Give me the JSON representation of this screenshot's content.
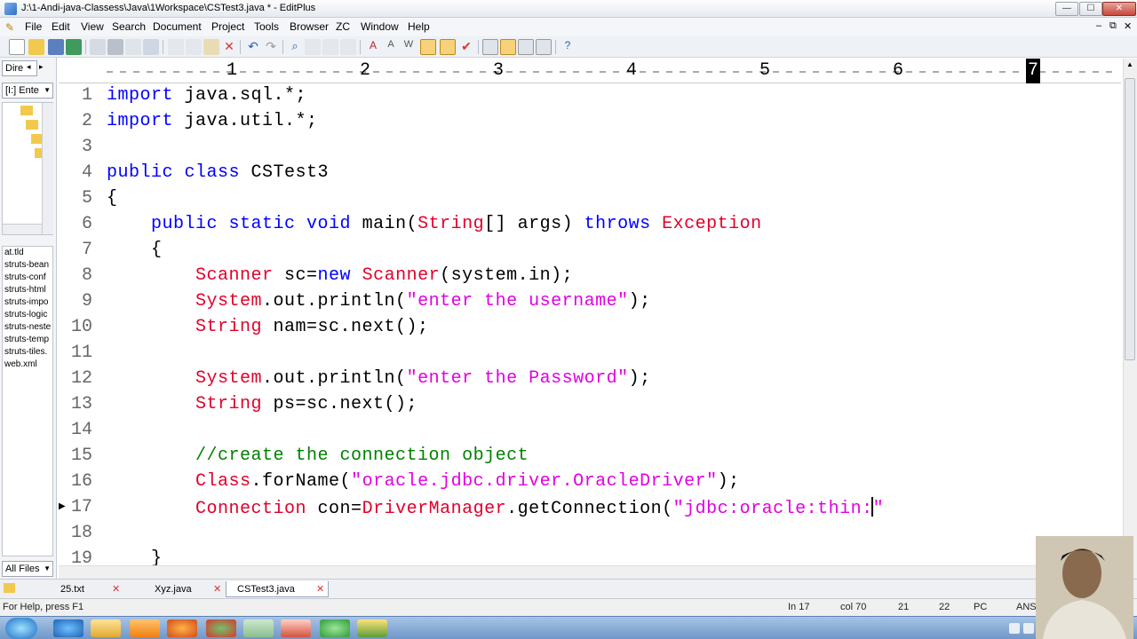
{
  "window": {
    "title": "J:\\1-Andi-java-Classess\\Java\\1Workspace\\CSTest3.java * - EditPlus",
    "min": "—",
    "max": "☐",
    "close": "✕"
  },
  "menu": [
    "File",
    "Edit",
    "View",
    "Search",
    "Document",
    "Project",
    "Tools",
    "Browser",
    "ZC",
    "Window",
    "Help"
  ],
  "left_panel": {
    "tab_label": "Dire",
    "drive": "[I:] Ente",
    "files": [
      "at.tld",
      "struts-bean",
      "struts-conf",
      "struts-html",
      "struts-impo",
      "struts-logic",
      "struts-neste",
      "struts-temp",
      "struts-tiles.",
      "web.xml"
    ],
    "filter": "All Files"
  },
  "ruler": {
    "numbers": [
      "1",
      "2",
      "3",
      "4",
      "5",
      "6"
    ],
    "marker": "7"
  },
  "editor": {
    "lines": [
      {
        "n": "1",
        "segs": [
          [
            "kw",
            "import"
          ],
          [
            "",
            " java.sql.*;"
          ]
        ]
      },
      {
        "n": "2",
        "segs": [
          [
            "kw",
            "import"
          ],
          [
            "",
            " java.util.*;"
          ]
        ]
      },
      {
        "n": "3",
        "segs": []
      },
      {
        "n": "4",
        "segs": [
          [
            "kw",
            "public class"
          ],
          [
            "",
            " CSTest3"
          ]
        ]
      },
      {
        "n": "5",
        "segs": [
          [
            "",
            "{"
          ]
        ]
      },
      {
        "n": "6",
        "segs": [
          [
            "",
            "    "
          ],
          [
            "kw",
            "public static void"
          ],
          [
            "",
            " main("
          ],
          [
            "ty",
            "String"
          ],
          [
            "",
            "[] args) "
          ],
          [
            "kw",
            "throws"
          ],
          [
            "",
            " "
          ],
          [
            "ty",
            "Exception"
          ]
        ]
      },
      {
        "n": "7",
        "segs": [
          [
            "",
            "    {"
          ]
        ]
      },
      {
        "n": "8",
        "segs": [
          [
            "",
            "        "
          ],
          [
            "ty",
            "Scanner"
          ],
          [
            "",
            " sc="
          ],
          [
            "kw",
            "new"
          ],
          [
            "",
            " "
          ],
          [
            "ty",
            "Scanner"
          ],
          [
            "",
            "(system.in);"
          ]
        ]
      },
      {
        "n": "9",
        "segs": [
          [
            "",
            "        "
          ],
          [
            "ty",
            "System"
          ],
          [
            "",
            ".out.println("
          ],
          [
            "st",
            "\"enter the username\""
          ],
          [
            "",
            ");"
          ]
        ]
      },
      {
        "n": "10",
        "segs": [
          [
            "",
            "        "
          ],
          [
            "ty",
            "String"
          ],
          [
            "",
            " nam=sc.next();"
          ]
        ]
      },
      {
        "n": "11",
        "segs": []
      },
      {
        "n": "12",
        "segs": [
          [
            "",
            "        "
          ],
          [
            "ty",
            "System"
          ],
          [
            "",
            ".out.println("
          ],
          [
            "st",
            "\"enter the Password\""
          ],
          [
            "",
            ");"
          ]
        ]
      },
      {
        "n": "13",
        "segs": [
          [
            "",
            "        "
          ],
          [
            "ty",
            "String"
          ],
          [
            "",
            " ps=sc.next();"
          ]
        ]
      },
      {
        "n": "14",
        "segs": []
      },
      {
        "n": "15",
        "segs": [
          [
            "",
            "        "
          ],
          [
            "cm",
            "//create the connection object"
          ]
        ]
      },
      {
        "n": "16",
        "segs": [
          [
            "",
            "        "
          ],
          [
            "ty",
            "Class"
          ],
          [
            "",
            ".forName("
          ],
          [
            "st",
            "\"oracle.jdbc.driver.OracleDriver\""
          ],
          [
            "",
            ");"
          ]
        ]
      },
      {
        "n": "17",
        "segs": [
          [
            "",
            "        "
          ],
          [
            "ty",
            "Connection"
          ],
          [
            "",
            " con="
          ],
          [
            "ty",
            "DriverManager"
          ],
          [
            "",
            ".getConnection("
          ],
          [
            "st",
            "\"jdbc:oracle:thin:\""
          ]
        ]
      },
      {
        "n": "18",
        "segs": []
      },
      {
        "n": "19",
        "segs": [
          [
            "",
            "    }"
          ]
        ]
      }
    ]
  },
  "doc_tabs": [
    "25.txt",
    "Xyz.java",
    "CSTest3.java"
  ],
  "status": {
    "help": "For Help, press F1",
    "line": "In 17",
    "col": "col 70",
    "v1": "21",
    "v2": "22",
    "mode": "PC",
    "enc": "ANS"
  },
  "colors": {
    "keyword": "#0000ff",
    "type": "#e0002a",
    "string": "#e000e0",
    "comment": "#008000"
  }
}
